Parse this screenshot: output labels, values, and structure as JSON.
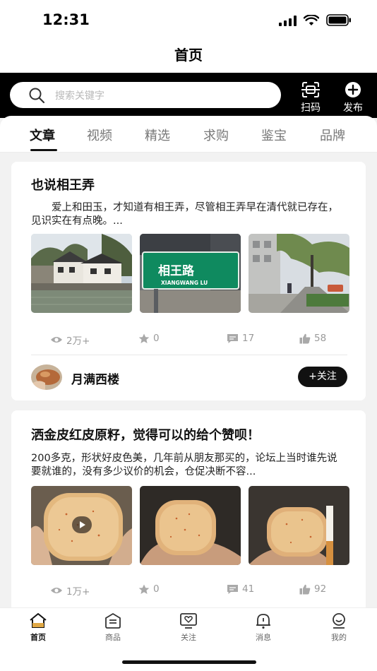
{
  "status_bar": {
    "time": "12:31"
  },
  "header": {
    "title": "首页"
  },
  "search": {
    "placeholder": "搜索关键字",
    "scan_label": "扫码",
    "publish_label": "发布"
  },
  "tabs": [
    {
      "label": "文章",
      "active": true
    },
    {
      "label": "视频"
    },
    {
      "label": "精选"
    },
    {
      "label": "求购"
    },
    {
      "label": "鉴宝"
    },
    {
      "label": "品牌"
    }
  ],
  "articles": [
    {
      "title": "也说相王弄",
      "excerpt": "　　爱上和田玉，才知道有相王弄，尽管相王弄早在清代就已存在，见识实在有点晚。...",
      "images": [
        {
          "subject": "riverside-houses"
        },
        {
          "subject": "street-sign",
          "sign_text": "相王路",
          "sign_subtext": "XIANGWANG LU"
        },
        {
          "subject": "tree-lined-street"
        }
      ],
      "stats": {
        "views": "2万+",
        "favorites": "0",
        "comments": "17",
        "likes": "58"
      },
      "author": {
        "name": "月满西楼",
        "follow_label": "+关注"
      }
    },
    {
      "title": "洒金皮红皮原籽，觉得可以的给个赞呗！",
      "excerpt": "200多克，形状好皮色美，几年前从朋友那买的，论坛上当时谁先说要就谁的，没有多少议价的机会，仓促决断不容...",
      "images": [
        {
          "subject": "jade-pebble-video",
          "has_video": true
        },
        {
          "subject": "jade-pebble"
        },
        {
          "subject": "jade-pebble-with-cigarette"
        }
      ],
      "stats": {
        "views": "1万+",
        "favorites": "0",
        "comments": "41",
        "likes": "92"
      }
    }
  ],
  "bottom_nav": [
    {
      "label": "首页",
      "icon": "home-icon",
      "active": true
    },
    {
      "label": "商品",
      "icon": "goods-icon"
    },
    {
      "label": "关注",
      "icon": "follow-icon"
    },
    {
      "label": "消息",
      "icon": "bell-icon"
    },
    {
      "label": "我的",
      "icon": "profile-icon"
    }
  ],
  "colors": {
    "accent": "#111111",
    "background": "#f2f2f2",
    "stat_gray": "#9a9a9a"
  }
}
